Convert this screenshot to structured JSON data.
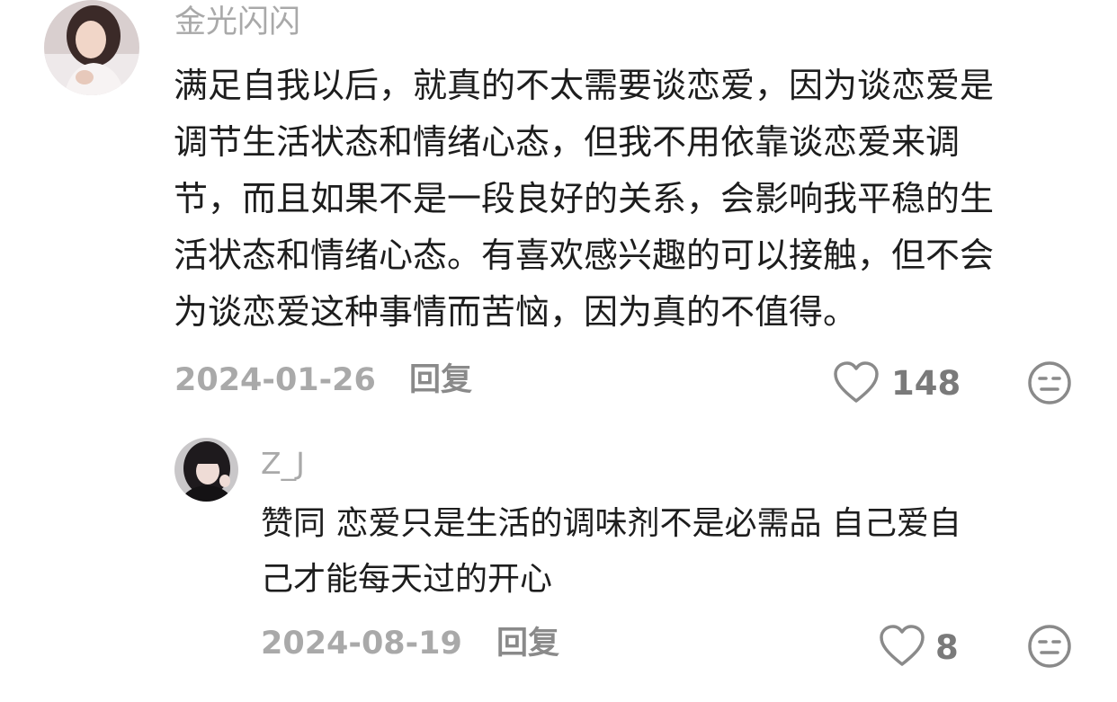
{
  "comment": {
    "avatar": "user-avatar",
    "username": "金光闪闪",
    "text_lines": [
      "满足自我以后，就真的不太需要谈恋爱，因为谈恋爱是",
      "调节生活状态和情绪心态，但我不用依靠谈恋爱来调",
      "节，而且如果不是一段良好的关系，会影响我平稳的生",
      "活状态和情绪心态。有喜欢感兴趣的可以接触，但不会",
      "为谈恋爱这种事情而苦恼，因为真的不值得。"
    ],
    "date": "2024-01-26",
    "reply_label": "回复",
    "like_count": "148",
    "like_icon": "heart-outline-icon",
    "dislike_icon": "meh-face-icon"
  },
  "reply": {
    "avatar": "user-avatar",
    "username": "Z_J",
    "text_lines": [
      "赞同 恋爱只是生活的调味剂不是必需品 自己爱自",
      "己才能每天过的开心"
    ],
    "date": "2024-08-19",
    "reply_label": "回复",
    "like_count": "8",
    "like_icon": "heart-outline-icon",
    "dislike_icon": "meh-face-icon"
  }
}
